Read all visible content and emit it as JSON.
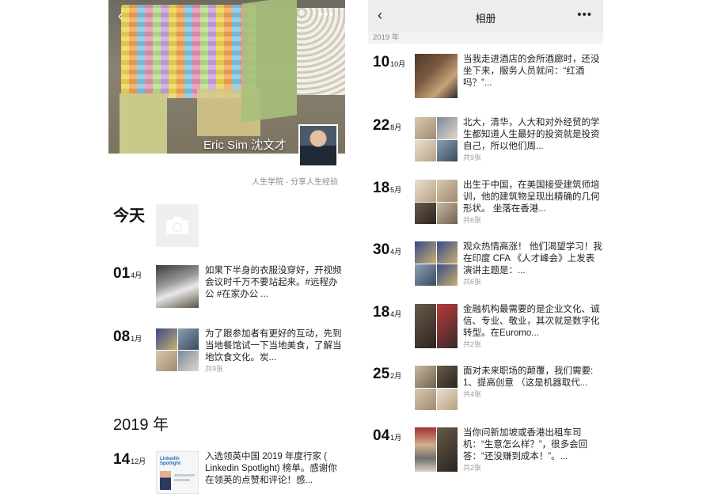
{
  "left_panel": {
    "cover_name": "Eric Sim 沈文才",
    "signature": "人生学院 - 分享人生经验",
    "today_label": "今天",
    "year_heading": "2019 年",
    "posts": [
      {
        "day": "01",
        "month": "4月",
        "text": "如果下半身的衣服没穿好，开视频会议时千万不要站起来。#远程办公 #在家办公 ...",
        "count": ""
      },
      {
        "day": "08",
        "month": "1月",
        "text": "为了跟参加者有更好的互动，先到当地餐馆试一下当地美食，了解当地饮食文化。炭...",
        "count": "共9张"
      },
      {
        "day": "14",
        "month": "12月",
        "text": "入选领英中国 2019 年度行家 ( Linkedin Spotlight) 榜单。感谢你在领英的点赞和评论！感...",
        "count": ""
      }
    ]
  },
  "right_panel": {
    "nav_title": "相册",
    "year_bar": "2019 年",
    "posts": [
      {
        "day": "10",
        "month": "10月",
        "text": "当我走进酒店的会所酒廊时，还没坐下来，服务人员就问：“红酒吗？”...",
        "count": ""
      },
      {
        "day": "22",
        "month": "8月",
        "text": "北大，清华，人大和对外经贸的学生都知道人生最好的投资就是投资自己，所以他们周...",
        "count": "共9张"
      },
      {
        "day": "18",
        "month": "5月",
        "text": "出生于中国，在美国接受建筑师培训，他的建筑物呈现出精确的几何形状。 坐落在香港...",
        "count": "共6张"
      },
      {
        "day": "30",
        "month": "4月",
        "text": "观众热情高涨！ 他们渴望学习！我在印度 CFA 《人才峰会》上发表演讲主题是：...",
        "count": "共6张"
      },
      {
        "day": "18",
        "month": "4月",
        "text": "金融机构最需要的是企业文化、诚信、专业、敬业，其次就是数字化转型。在Euromo...",
        "count": "共2张"
      },
      {
        "day": "25",
        "month": "2月",
        "text": "面对未来职场的颠覆，我们需要:\n1、提高创意 （这是机器取代...",
        "count": "共4张"
      },
      {
        "day": "04",
        "month": "1月",
        "text": "当你问新加坡或香港出租车司机：“生意怎么样？”，很多会回答：“还没赚到成本！”。...",
        "count": "共2张"
      }
    ]
  },
  "icons": {
    "back": "chevron-left-icon",
    "more": "more-dots-icon",
    "camera": "camera-icon"
  },
  "linkedin_thumb_label": "LinkedIn Spotlight"
}
